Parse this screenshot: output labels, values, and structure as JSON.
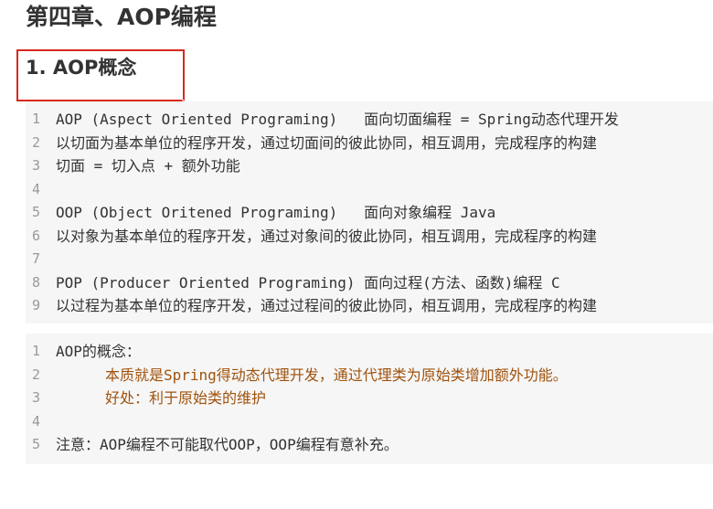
{
  "chapter_title": "第四章、AOP编程",
  "section_title": "1. AOP概念",
  "code_block_1": {
    "lines": [
      {
        "number": "1",
        "text": "AOP (Aspect Oriented Programing)   面向切面编程 = Spring动态代理开发"
      },
      {
        "number": "2",
        "text": "以切面为基本单位的程序开发，通过切面间的彼此协同，相互调用，完成程序的构建"
      },
      {
        "number": "3",
        "text": "切面 = 切入点 + 额外功能"
      },
      {
        "number": "4",
        "text": ""
      },
      {
        "number": "5",
        "text": "OOP (Object Oritened Programing)   面向对象编程 Java"
      },
      {
        "number": "6",
        "text": "以对象为基本单位的程序开发，通过对象间的彼此协同，相互调用，完成程序的构建"
      },
      {
        "number": "7",
        "text": ""
      },
      {
        "number": "8",
        "text": "POP (Producer Oriented Programing) 面向过程(方法、函数)编程 C"
      },
      {
        "number": "9",
        "text": "以过程为基本单位的程序开发，通过过程间的彼此协同，相互调用，完成程序的构建"
      }
    ]
  },
  "code_block_2": {
    "lines": [
      {
        "number": "1",
        "text": "AOP的概念："
      },
      {
        "number": "2",
        "text": "本质就是Spring得动态代理开发，通过代理类为原始类增加额外功能。"
      },
      {
        "number": "3",
        "text": "好处：利于原始类的维护"
      },
      {
        "number": "4",
        "text": ""
      },
      {
        "number": "5",
        "text": "注意：AOP编程不可能取代OOP，OOP编程有意补充。"
      }
    ]
  },
  "colors": {
    "highlight_border": "#d9281e",
    "code_background": "#f6f6f6",
    "comment_text": "#a0520d",
    "line_number": "#999999"
  }
}
